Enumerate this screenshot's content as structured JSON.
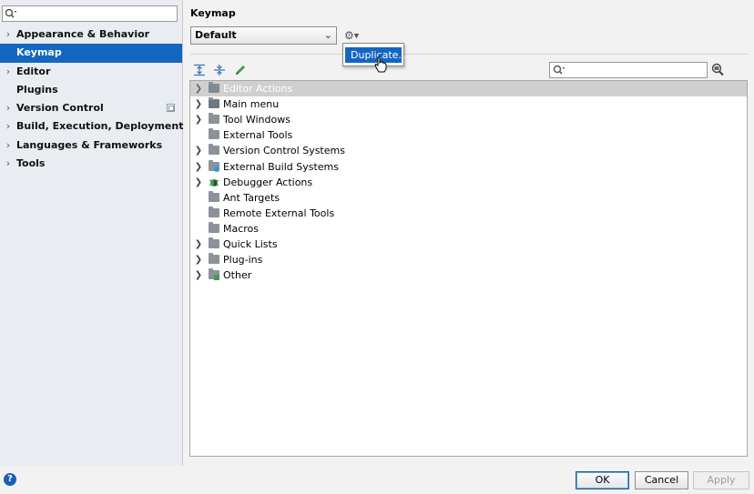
{
  "sidebar": {
    "search_placeholder": "",
    "items": [
      {
        "label": "Appearance & Behavior",
        "expandable": true
      },
      {
        "label": "Keymap",
        "expandable": false,
        "selected": true
      },
      {
        "label": "Editor",
        "expandable": true
      },
      {
        "label": "Plugins",
        "expandable": false
      },
      {
        "label": "Version Control",
        "expandable": true,
        "project_icon": true
      },
      {
        "label": "Build, Execution, Deployment",
        "expandable": true
      },
      {
        "label": "Languages & Frameworks",
        "expandable": true
      },
      {
        "label": "Tools",
        "expandable": true
      }
    ]
  },
  "main": {
    "title": "Keymap",
    "scheme_value": "Default",
    "gear_icon": "gear-icon",
    "popup": {
      "item": "Duplicate..."
    },
    "toolbar": {
      "expand_icon": "expand-all-icon",
      "collapse_icon": "collapse-all-icon",
      "edit_icon": "edit-shortcut-icon"
    },
    "filter_placeholder": "",
    "tree": [
      {
        "label": "Editor Actions",
        "expandable": true,
        "icon": "editor-icon"
      },
      {
        "label": "Main menu",
        "expandable": true,
        "icon": "menu-icon"
      },
      {
        "label": "Tool Windows",
        "expandable": true,
        "icon": "folder-icon"
      },
      {
        "label": "External Tools",
        "expandable": false,
        "icon": "folder-icon"
      },
      {
        "label": "Version Control Systems",
        "expandable": true,
        "icon": "folder-icon"
      },
      {
        "label": "External Build Systems",
        "expandable": true,
        "icon": "build-folder-icon"
      },
      {
        "label": "Debugger Actions",
        "expandable": true,
        "icon": "bug-icon"
      },
      {
        "label": "Ant Targets",
        "expandable": false,
        "icon": "folder-icon"
      },
      {
        "label": "Remote External Tools",
        "expandable": false,
        "icon": "folder-icon"
      },
      {
        "label": "Macros",
        "expandable": false,
        "icon": "folder-icon"
      },
      {
        "label": "Quick Lists",
        "expandable": true,
        "icon": "folder-icon"
      },
      {
        "label": "Plug-ins",
        "expandable": true,
        "icon": "folder-icon"
      },
      {
        "label": "Other",
        "expandable": true,
        "icon": "other-folder-icon"
      }
    ]
  },
  "footer": {
    "help_label": "?",
    "ok_label": "OK",
    "cancel_label": "Cancel",
    "apply_label": "Apply"
  },
  "colors": {
    "selection": "#1466c1",
    "sidebar_bg": "#e9edf1"
  }
}
